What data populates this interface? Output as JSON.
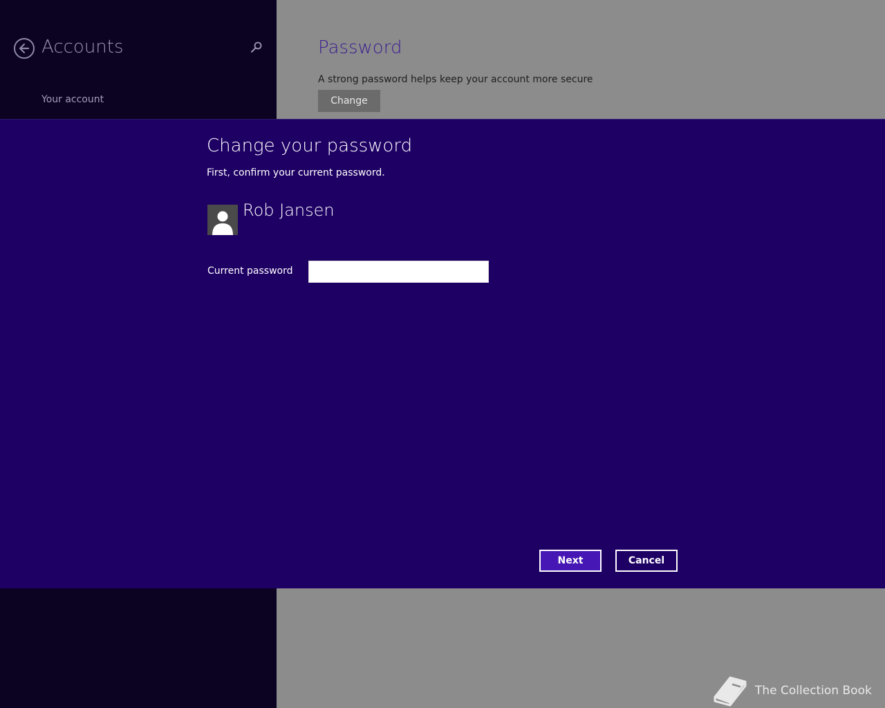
{
  "app": {
    "title": "Accounts",
    "nav_items": [
      {
        "label": "Your account"
      }
    ]
  },
  "settings": {
    "section_title": "Password",
    "description": "A strong password helps keep your account more secure",
    "change_label": "Change"
  },
  "dialog": {
    "title": "Change your password",
    "subtitle": "First, confirm your current password.",
    "user_name": "Rob Jansen",
    "field_label": "Current password",
    "field_value": "",
    "next_label": "Next",
    "cancel_label": "Cancel"
  },
  "watermark": {
    "text": "The Collection Book",
    "icon": "book-icon"
  },
  "colors": {
    "dialog_bg": "#1e0064",
    "accent": "#4617b4",
    "left_pane": "#0c0222",
    "right_pane": "#8c8c8c"
  }
}
